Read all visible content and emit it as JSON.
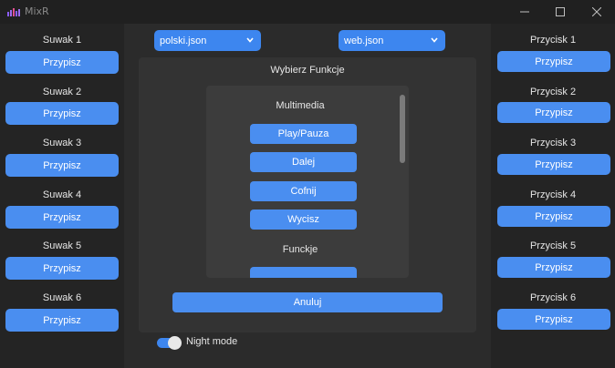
{
  "window": {
    "title": "MixR",
    "icon": "equalizer-icon",
    "controls": [
      "minimize-icon",
      "maximize-icon",
      "close-icon"
    ]
  },
  "left": {
    "sliders": [
      {
        "label": "Suwak 1",
        "button": "Przypisz"
      },
      {
        "label": "Suwak 2",
        "button": "Przypisz"
      },
      {
        "label": "Suwak 3",
        "button": "Przypisz"
      },
      {
        "label": "Suwak 4",
        "button": "Przypisz"
      },
      {
        "label": "Suwak 5",
        "button": "Przypisz"
      },
      {
        "label": "Suwak 6",
        "button": "Przypisz"
      }
    ]
  },
  "right": {
    "buttons": [
      {
        "label": "Przycisk 1",
        "button": "Przypisz"
      },
      {
        "label": "Przycisk 2",
        "button": "Przypisz"
      },
      {
        "label": "Przycisk 3",
        "button": "Przypisz"
      },
      {
        "label": "Przycisk 4",
        "button": "Przypisz"
      },
      {
        "label": "Przycisk 5",
        "button": "Przypisz"
      },
      {
        "label": "Przycisk 6",
        "button": "Przypisz"
      }
    ]
  },
  "center": {
    "language_select": "polski.json",
    "profile_select": "web.json",
    "panel_title": "Wybierz Funkcje",
    "sections": [
      {
        "title": "Multimedia",
        "items": [
          "Play/Pauza",
          "Dalej",
          "Cofnij",
          "Wycisz"
        ]
      },
      {
        "title": "Funckje",
        "items": [
          ""
        ]
      }
    ],
    "cancel": "Anuluj",
    "night_mode": {
      "label": "Night mode",
      "enabled": true
    }
  },
  "colors": {
    "accent": "#4a8ef0",
    "background": "#242424",
    "panel": "#333333"
  }
}
